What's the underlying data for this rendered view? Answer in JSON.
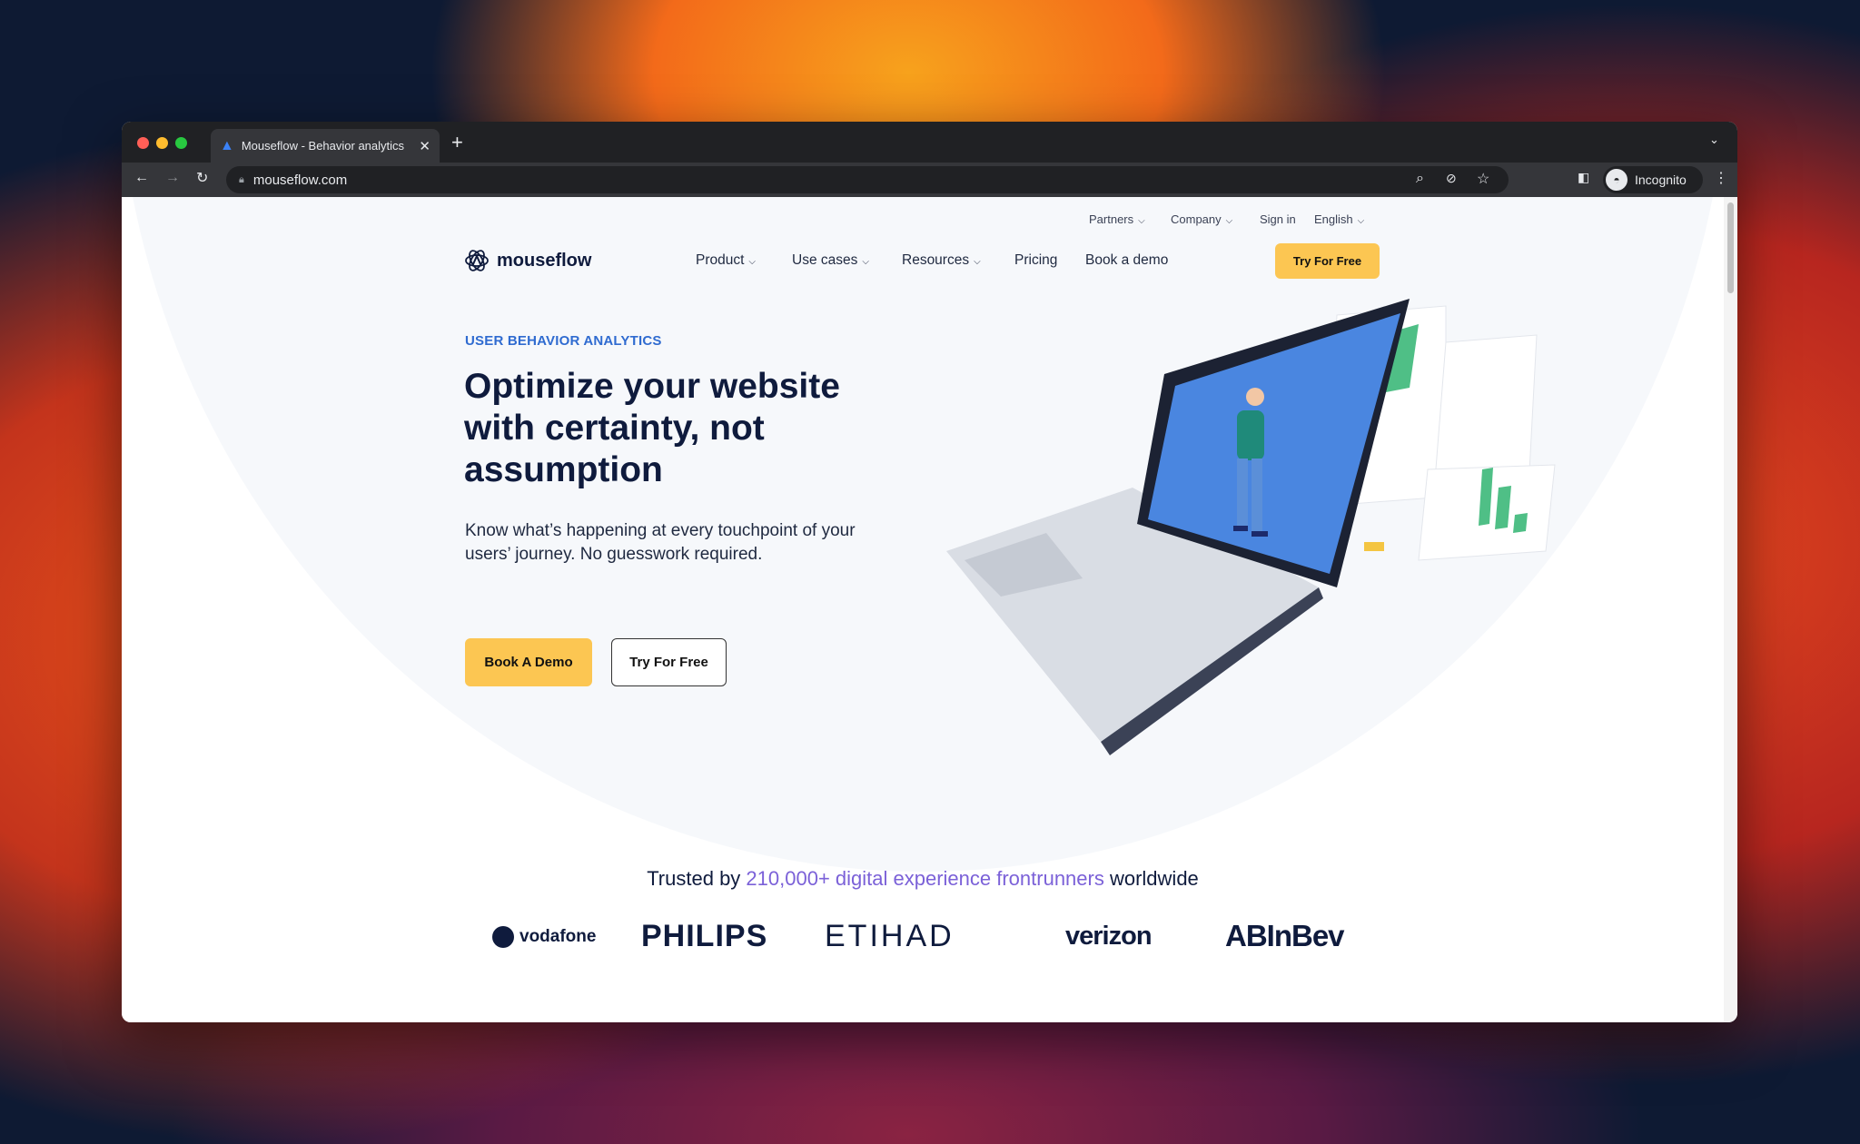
{
  "browser": {
    "tab_title": "Mouseflow - Behavior analytics",
    "url": "mouseflow.com",
    "profile": "Incognito",
    "colors": {
      "close": "#ff5f57",
      "minimize": "#febc2e",
      "maximize": "#28c840"
    }
  },
  "site": {
    "utility_nav": [
      {
        "label": "Partners",
        "dropdown": true
      },
      {
        "label": "Company",
        "dropdown": true
      },
      {
        "label": "Sign in",
        "dropdown": false
      },
      {
        "label": "English",
        "dropdown": true
      }
    ],
    "logo": "mouseflow",
    "main_nav": [
      {
        "label": "Product",
        "dropdown": true
      },
      {
        "label": "Use cases",
        "dropdown": true
      },
      {
        "label": "Resources",
        "dropdown": true
      },
      {
        "label": "Pricing",
        "dropdown": false
      },
      {
        "label": "Book a demo",
        "dropdown": false
      }
    ],
    "nav_cta": "Try For Free",
    "hero": {
      "eyebrow": "USER BEHAVIOR ANALYTICS",
      "headline": "Optimize your website with certainty, not assumption",
      "subtext": "Know what’s happening at every touchpoint of your users’ journey. No guesswork required.",
      "primary_button": "Book A Demo",
      "secondary_button": "Try For Free"
    },
    "trusted": {
      "prefix": "Trusted by ",
      "highlight": "210,000+ digital experience frontrunners",
      "suffix": " worldwide"
    },
    "client_logos": [
      "vodafone",
      "PHILIPS",
      "ETIHAD",
      "verizon",
      "ABInBev"
    ],
    "colors": {
      "accent_yellow": "#fcc652",
      "eyebrow_blue": "#2f6bd0",
      "highlight_purple": "#7b61d8",
      "heading_navy": "#0f1b3d"
    }
  }
}
